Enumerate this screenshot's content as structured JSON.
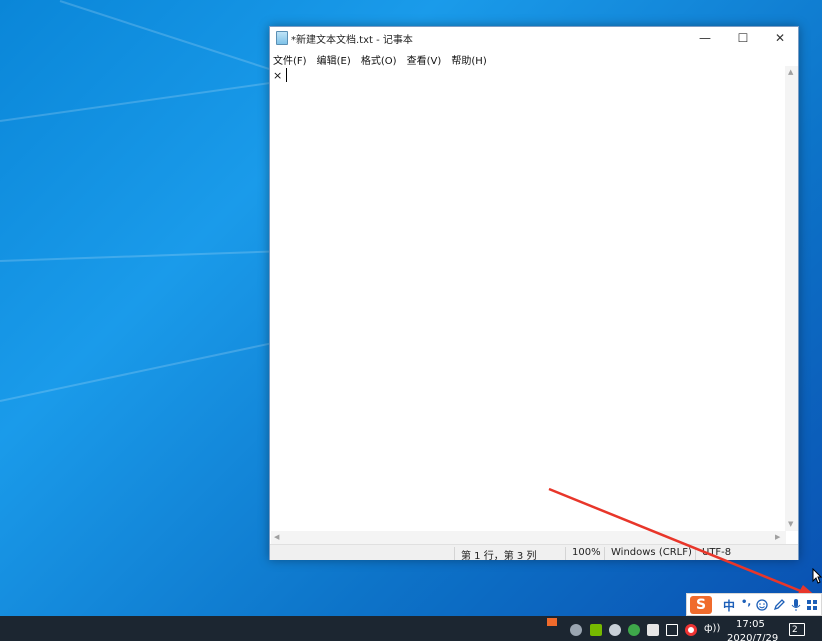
{
  "window": {
    "title": "*新建文本文档.txt - 记事本",
    "controls": {
      "minimize": "—",
      "maximize": "☐",
      "close": "✕"
    }
  },
  "menu": [
    {
      "label": "文件(F)"
    },
    {
      "label": "编辑(E)"
    },
    {
      "label": "格式(O)"
    },
    {
      "label": "查看(V)"
    },
    {
      "label": "帮助(H)"
    }
  ],
  "editor": {
    "text": "×"
  },
  "status": {
    "position": "第 1 行，第 3 列",
    "zoom": "100%",
    "line_ending": "Windows (CRLF)",
    "encoding": "UTF-8"
  },
  "ime": {
    "logo": "S",
    "mode": "中",
    "punct": "•,",
    "icons": [
      "emoji-icon",
      "pen-icon",
      "mic-icon",
      "toolbox-icon"
    ]
  },
  "tray": {
    "icons": [
      "sogou-icon",
      "skype-icon",
      "nvidia-icon",
      "network-icon",
      "security-icon",
      "shield-icon",
      "display-icon",
      "record-icon",
      "volume-icon"
    ],
    "volume": "ф))"
  },
  "clock": {
    "time": "17:05",
    "date": "2020/7/29"
  },
  "notifications": {
    "count": "2"
  },
  "colors": {
    "annotation_arrow": "#e8362a",
    "ime_brand": "#f06b2c",
    "taskbar": "#1c2631"
  }
}
